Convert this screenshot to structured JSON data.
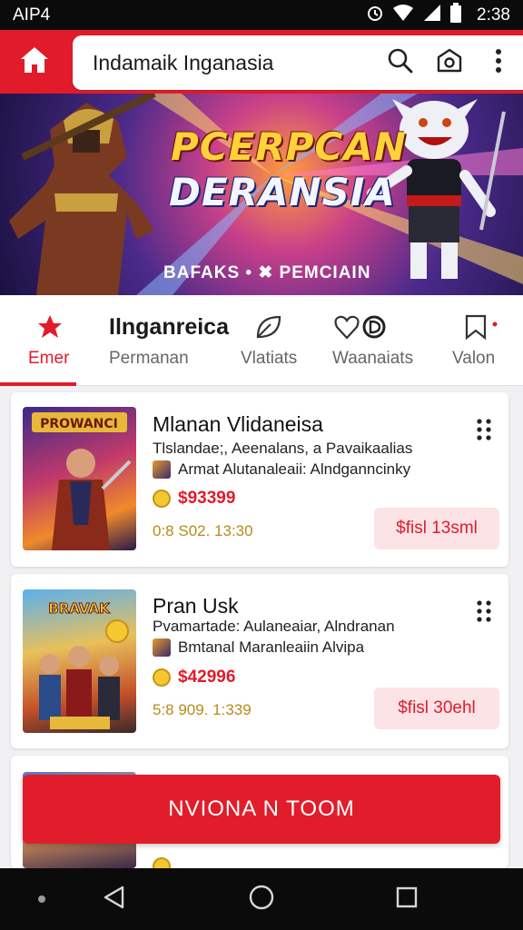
{
  "status_bar": {
    "carrier": "AIP4",
    "time": "2:38"
  },
  "header": {
    "title": "Indamaik Inganasia",
    "icons": [
      "home-icon",
      "search-icon",
      "camera-icon",
      "more-vertical-icon"
    ]
  },
  "banner": {
    "title_line1": "PCERPCAN",
    "title_line2": "DERANSIA",
    "subtitle": "BAFAKS • ✖ PEMCIAIN"
  },
  "tabs": {
    "heading": "Ilnganreica",
    "items": [
      {
        "label": "Emer",
        "icon": "star-icon",
        "active": true
      },
      {
        "label": "Permanan",
        "icon": "",
        "active": false
      },
      {
        "label": "Vlatiats",
        "icon": "leaf-icon",
        "active": false
      },
      {
        "label": "Waanaiats",
        "icon": "heart-icon",
        "active": false
      },
      {
        "label": "Valon",
        "icon": "bookmark-icon",
        "active": false
      }
    ],
    "accent": "#e21b2a"
  },
  "products": [
    {
      "name": "Mlanan Vlidaneisa",
      "meta1": "Tlslandae;, Aeenalans, a Pavaikaalias",
      "meta2": "Armat Alutanaleaii: Alndganncinky",
      "price": "$93399",
      "sold": "0:8 S02. 13:30",
      "action": "$fisl 13sml",
      "thumb_title": "PROWANCI"
    },
    {
      "name": "Pran Usk",
      "meta1": "Pvamartade: Aulaneaiar, Alndranan",
      "meta2": "Bmtanal Maranleaiin Alvipa",
      "price": "$42996",
      "sold": "5:8 909. 1:339",
      "action": "$fisl 30ehl",
      "thumb_title": "BRAVAK"
    }
  ],
  "cta": {
    "label": "NVIONA N TOOM"
  },
  "colors": {
    "brand_red": "#e21b2a",
    "cta_red": "#e11d2b",
    "sold_gold": "#b88a1a"
  }
}
